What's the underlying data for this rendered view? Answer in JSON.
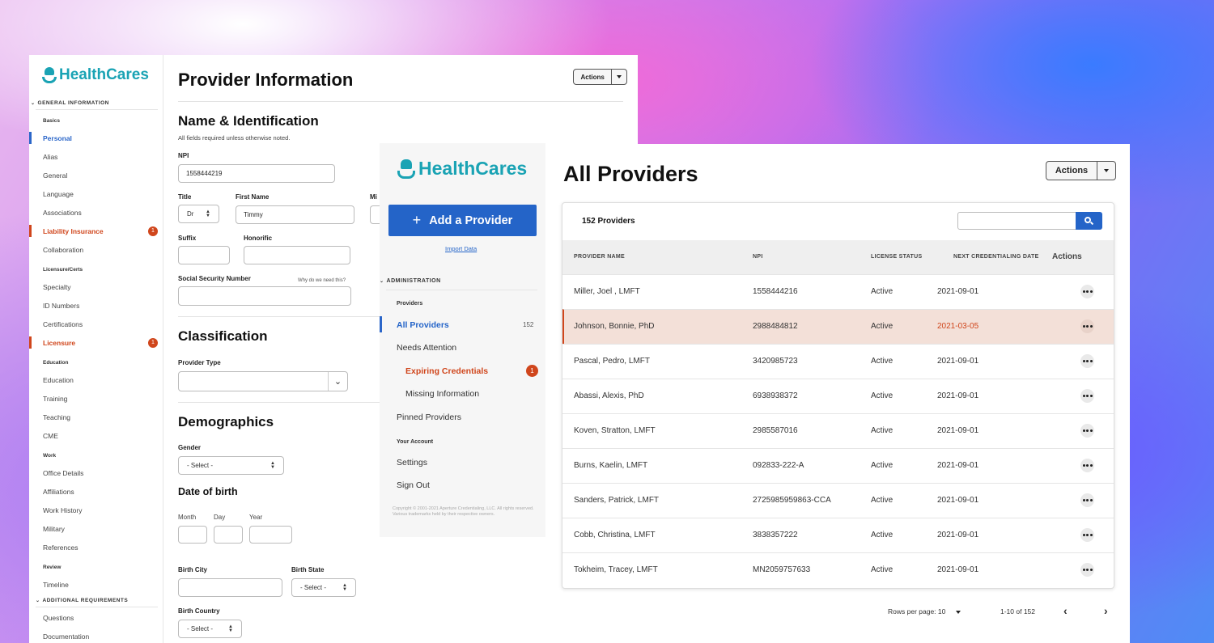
{
  "colors": {
    "brand": "#1aa3b4",
    "primary": "#2464c8",
    "warning": "#d0461c",
    "row_highlight": "#f3e0d8"
  },
  "logo_text": "HealthCares",
  "provider_info": {
    "title": "Provider Information",
    "actions_label": "Actions",
    "sidebar": {
      "general_section": "GENERAL INFORMATION",
      "basics_label": "Basics",
      "basics": [
        "Personal",
        "Alias",
        "General",
        "Language",
        "Associations",
        "Liability Insurance",
        "Collaboration"
      ],
      "licensure_label": "Licensure/Certs",
      "licensure": [
        "Specialty",
        "ID Numbers",
        "Certifications",
        "Licensure"
      ],
      "education_label": "Education",
      "education": [
        "Education",
        "Training",
        "Teaching",
        "CME"
      ],
      "work_label": "Work",
      "work": [
        "Office Details",
        "Affiliations",
        "Work History",
        "Military",
        "References"
      ],
      "review_label": "Review",
      "review": [
        "Timeline"
      ],
      "additional_section": "ADDITIONAL REQUIREMENTS",
      "additional": [
        "Questions",
        "Documentation"
      ],
      "badge_count": "1"
    },
    "name_section": {
      "heading": "Name & Identification",
      "note": "All fields required unless otherwise noted.",
      "npi_label": "NPI",
      "npi_value": "1558444219",
      "title_label": "Title",
      "title_value": "Dr",
      "first_name_label": "First Name",
      "first_name_value": "Timmy",
      "middle_label": "Mi",
      "suffix_label": "Suffix",
      "honorific_label": "Honorific",
      "ssn_label": "Social Security Number",
      "ssn_help": "Why do we need this?"
    },
    "classification": {
      "heading": "Classification",
      "provider_type_label": "Provider Type"
    },
    "demographics": {
      "heading": "Demographics",
      "gender_label": "Gender",
      "select_placeholder": "- Select -",
      "dob_heading": "Date of birth",
      "month_label": "Month",
      "day_label": "Day",
      "year_label": "Year",
      "birth_city_label": "Birth City",
      "birth_state_label": "Birth State",
      "birth_country_label": "Birth Country"
    }
  },
  "admin_sidebar": {
    "add_button": "Add a Provider",
    "import_link": "Import Data",
    "section": "ADMINISTRATION",
    "providers_label": "Providers",
    "all_providers": "All Providers",
    "all_providers_count": "152",
    "needs_attention": "Needs Attention",
    "expiring": "Expiring Credentials",
    "expiring_count": "1",
    "missing": "Missing Information",
    "pinned": "Pinned Providers",
    "account_label": "Your Account",
    "settings": "Settings",
    "signout": "Sign Out",
    "copyright": "Copyright © 2001-2021 Aperture Credentialing, LLC. All rights reserved. Various trademarks held by their respective owners."
  },
  "all_providers": {
    "title": "All Providers",
    "actions_label": "Actions",
    "count_label": "152 Providers",
    "columns": [
      "PROVIDER NAME",
      "NPI",
      "LICENSE STATUS",
      "NEXT CREDENTIALING DATE",
      "Actions"
    ],
    "rows": [
      {
        "name": "Miller, Joel , LMFT",
        "npi": "1558444216",
        "status": "Active",
        "date": "2021-09-01"
      },
      {
        "name": "Johnson, Bonnie, PhD",
        "npi": "2988484812",
        "status": "Active",
        "date": "2021-03-05"
      },
      {
        "name": "Pascal, Pedro, LMFT",
        "npi": "3420985723",
        "status": "Active",
        "date": "2021-09-01"
      },
      {
        "name": "Abassi, Alexis, PhD",
        "npi": "6938938372",
        "status": "Active",
        "date": "2021-09-01"
      },
      {
        "name": "Koven, Stratton, LMFT",
        "npi": "2985587016",
        "status": "Active",
        "date": "2021-09-01"
      },
      {
        "name": "Burns, Kaelin, LMFT",
        "npi": "092833-222-A",
        "status": "Active",
        "date": "2021-09-01"
      },
      {
        "name": "Sanders, Patrick, LMFT",
        "npi": "2725985959863-CCA",
        "status": "Active",
        "date": "2021-09-01"
      },
      {
        "name": "Cobb, Christina, LMFT",
        "npi": "3838357222",
        "status": "Active",
        "date": "2021-09-01"
      },
      {
        "name": "Tokheim, Tracey, LMFT",
        "npi": "MN2059757633",
        "status": "Active",
        "date": "2021-09-01"
      }
    ],
    "rows_per_page_label": "Rows per page: 10",
    "range_label": "1-10 of 152"
  }
}
